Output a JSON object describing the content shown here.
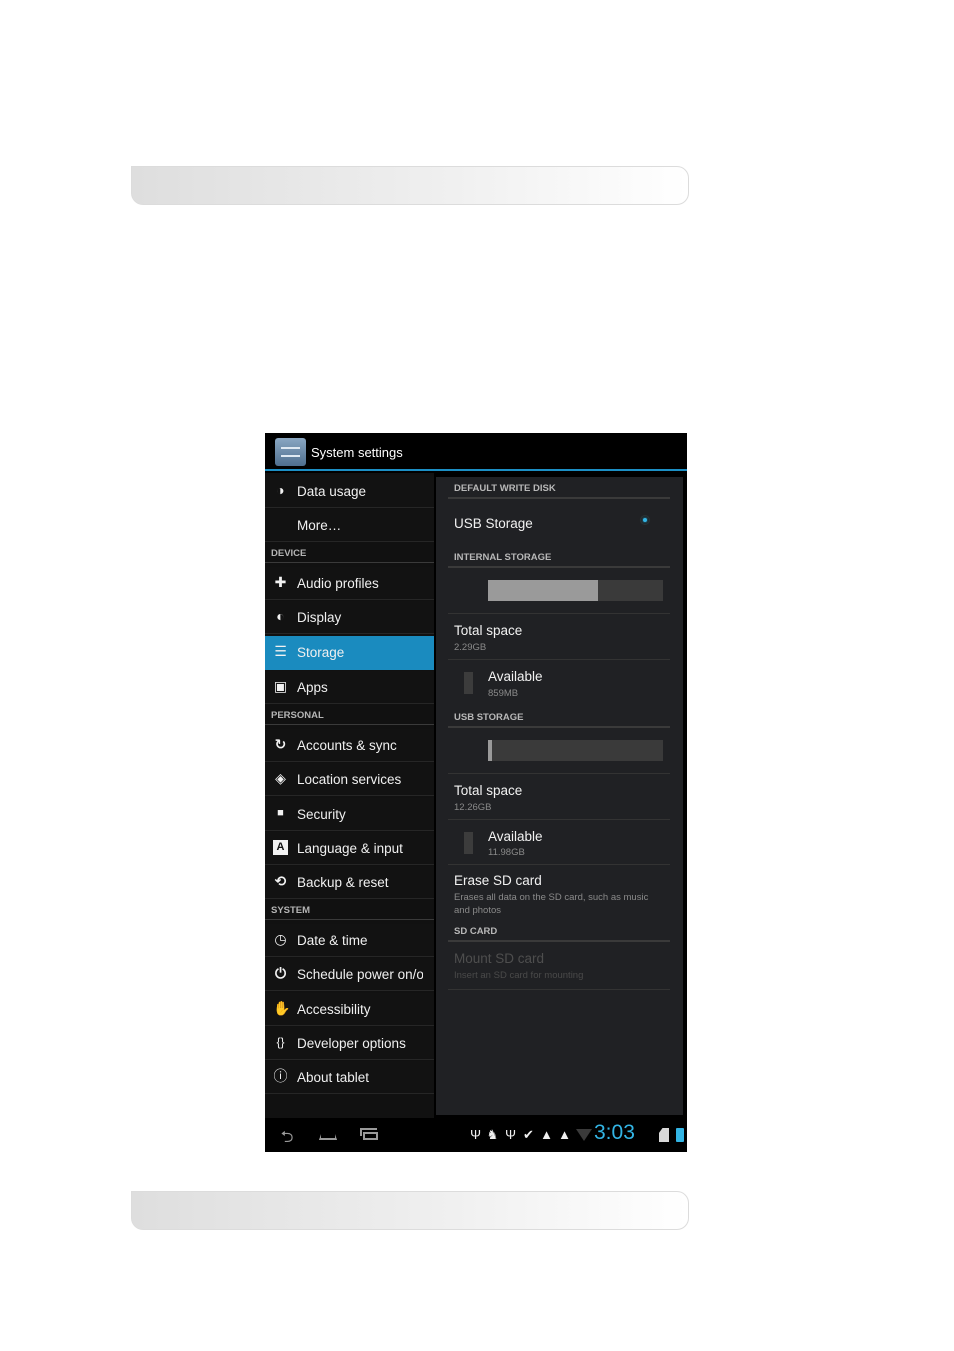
{
  "window": {
    "title": "System settings",
    "app_icon": "settings-sliders-icon"
  },
  "sidebar": {
    "items": [
      {
        "label": "Data usage",
        "icon": "data-usage-icon",
        "glyph": "◑"
      },
      {
        "label": "More…",
        "icon": "",
        "glyph": ""
      },
      {
        "label": "Audio profiles",
        "icon": "audio-profiles-icon",
        "glyph": "✚"
      },
      {
        "label": "Display",
        "icon": "display-icon",
        "glyph": "◐"
      },
      {
        "label": "Storage",
        "icon": "storage-icon",
        "glyph": "☰"
      },
      {
        "label": "Apps",
        "icon": "apps-icon",
        "glyph": "▣"
      },
      {
        "label": "Accounts & sync",
        "icon": "sync-icon",
        "glyph": "↻"
      },
      {
        "label": "Location services",
        "icon": "location-icon",
        "glyph": "◈"
      },
      {
        "label": "Security",
        "icon": "lock-icon",
        "glyph": "■"
      },
      {
        "label": "Language & input",
        "icon": "language-icon",
        "glyph": "A"
      },
      {
        "label": "Backup & reset",
        "icon": "backup-icon",
        "glyph": "⟲"
      },
      {
        "label": "Date & time",
        "icon": "clock-icon",
        "glyph": "◷"
      },
      {
        "label": "Schedule power on/off",
        "icon": "schedule-power-icon",
        "glyph": "⏻"
      },
      {
        "label": "Accessibility",
        "icon": "hand-icon",
        "glyph": "✋"
      },
      {
        "label": "Developer options",
        "icon": "braces-icon",
        "glyph": "{}"
      },
      {
        "label": "About tablet",
        "icon": "info-icon",
        "glyph": "ⓘ"
      }
    ],
    "headers": {
      "device": "DEVICE",
      "personal": "PERSONAL",
      "system": "SYSTEM"
    },
    "active_index": 4,
    "active_color": "#1a8bbf"
  },
  "content": {
    "default_write_disk": {
      "header": "DEFAULT WRITE DISK",
      "option": "USB Storage",
      "selected": true
    },
    "internal_storage": {
      "header": "INTERNAL STORAGE",
      "used_fraction": 0.63,
      "total_title": "Total space",
      "total_value": "2.29GB",
      "available_title": "Available",
      "available_value": "859MB"
    },
    "usb_storage": {
      "header": "USB STORAGE",
      "used_fraction": 0.02,
      "total_title": "Total space",
      "total_value": "12.26GB",
      "available_title": "Available",
      "available_value": "11.98GB",
      "erase_title": "Erase SD card",
      "erase_sub": "Erases all data on the SD card, such as music and photos"
    },
    "sd_card": {
      "header": "SD CARD",
      "mount_title": "Mount SD card",
      "mount_sub": "Insert an SD card for mounting"
    }
  },
  "navbar": {
    "back_icon": "back-icon",
    "home_icon": "home-icon",
    "recent_icon": "recent-apps-icon",
    "clock": "3:03",
    "accent": "#33b5e5"
  }
}
